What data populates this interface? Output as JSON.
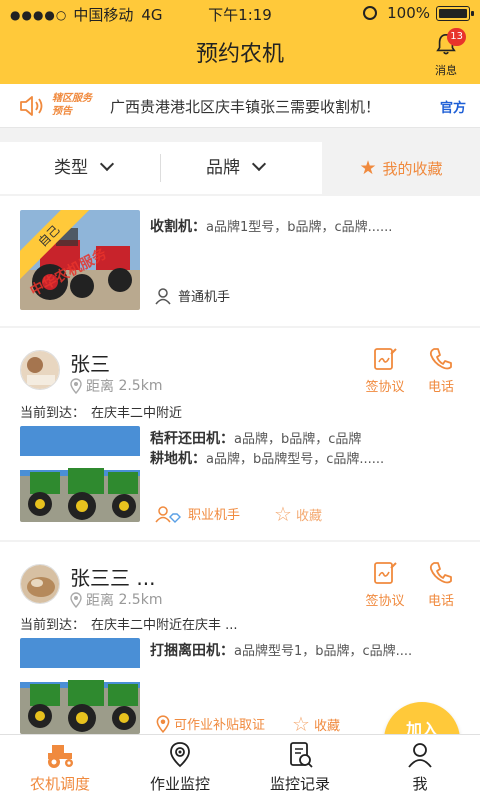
{
  "statusbar": {
    "carrier": "中国移动",
    "network": "4G",
    "time": "下午1:19",
    "battery": "100%"
  },
  "header": {
    "title": "预约农机",
    "messages_label": "消息",
    "messages_badge": "13"
  },
  "notice": {
    "tag": "辖区服务预告",
    "text": "广西贵港港北区庆丰镇张三需要收割机！",
    "official": "官方"
  },
  "filters": {
    "type_label": "类型",
    "brand_label": "品牌",
    "favorites_label": "我的收藏"
  },
  "cards": [
    {
      "ribbon": "自己",
      "watermark": "中华农机服务",
      "machines": [
        {
          "name": "收割机：",
          "detail": "a品牌1型号，b品牌，c品牌......"
        }
      ],
      "role": "普通机手"
    },
    {
      "name": "张三",
      "distance_label": "距离",
      "distance": "2.5km",
      "arrived_label": "当前到达：",
      "arrived_place": "在庆丰二中附近",
      "sign_label": "签协议",
      "phone_label": "电话",
      "machines": [
        {
          "name": "秸秆还田机：",
          "detail": "a品牌，b品牌，c品牌"
        },
        {
          "name": "耕地机：",
          "detail": "a品牌，b品牌型号，c品牌......"
        }
      ],
      "role": "职业机手",
      "favorite_label": "收藏"
    },
    {
      "name": "张三三 ...",
      "distance_label": "距离",
      "distance": "2.5km",
      "arrived_label": "当前到达：",
      "arrived_place": "在庆丰二中附近在庆丰 ...",
      "sign_label": "签协议",
      "phone_label": "电话",
      "machines": [
        {
          "name": "打捆离田机：",
          "detail": "a品牌型号1，b品牌，c品牌...."
        }
      ],
      "subsidy_label": "可作业补贴取证",
      "favorite_label": "收藏"
    }
  ],
  "join_label": "加入",
  "tabs": [
    {
      "label": "农机调度",
      "icon": "tractor-icon",
      "active": true
    },
    {
      "label": "作业监控",
      "icon": "location-monitor-icon",
      "active": false
    },
    {
      "label": "监控记录",
      "icon": "record-icon",
      "active": false
    },
    {
      "label": "我",
      "icon": "person-icon",
      "active": false
    }
  ],
  "colors": {
    "brand_yellow": "#ffc93a",
    "accent_orange": "#f08a3e",
    "official_blue": "#1e5fd6",
    "badge_red": "#e8332b"
  }
}
